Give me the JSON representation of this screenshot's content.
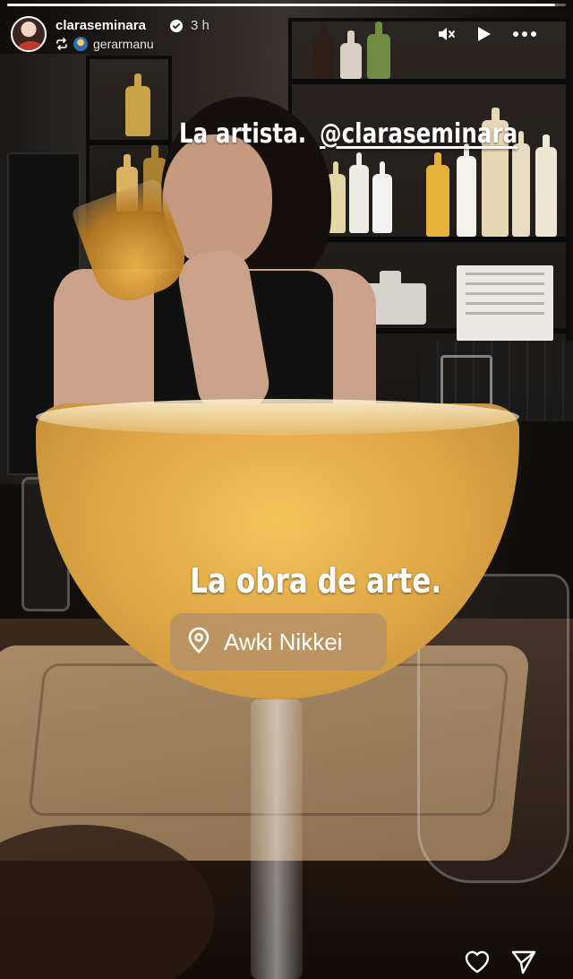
{
  "story": {
    "progress": 0.98,
    "author": {
      "username": "claraseminara",
      "verified": true,
      "time_ago": "3 h"
    },
    "reposted_from": {
      "username": "gerarmanu"
    },
    "controls": {
      "mute_icon": "speaker-muted-icon",
      "play_icon": "play-icon",
      "more_icon": "more-dots-icon"
    }
  },
  "stickers": {
    "caption_top": "La artista.",
    "mention": "@claraseminara",
    "caption_center": "La obra de arte."
  },
  "location_sticker": {
    "icon": "location-pin-icon",
    "label": "Awki Nikkei"
  },
  "footer": {
    "like_icon": "heart-icon",
    "share_icon": "send-icon"
  },
  "colors": {
    "accent": "#ffffff",
    "location_bg": "#ae8e6e",
    "drink": "#dca443"
  }
}
